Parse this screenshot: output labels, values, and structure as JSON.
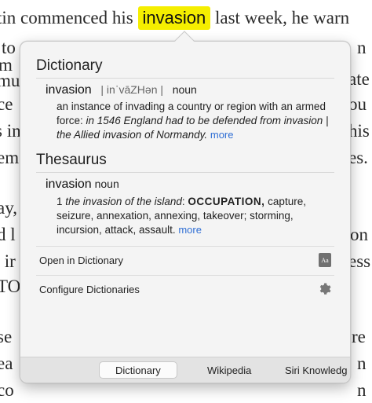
{
  "background": {
    "line1_before": "tin commenced his",
    "highlight_word": "invasion",
    "line1_after": "last week, he warn",
    "left_fragments": [
      "to",
      "m",
      "mu",
      "ce",
      "s in",
      "em",
      "ay,",
      "d l",
      "’ ir",
      "TO",
      "se",
      "ea",
      "co"
    ],
    "right_fragments": [
      "n",
      "ate",
      "ou",
      "his",
      "es.",
      "on",
      "ess",
      "re",
      "n",
      "n"
    ]
  },
  "popover": {
    "dictionary": {
      "title": "Dictionary",
      "headword": "invasion",
      "pronunciation": "| inˈvāZHən |",
      "pos": "noun",
      "definition": "an instance of invading a country or region with an armed force: ",
      "example": "in 1546 England had to be defended from invasion | the Allied invasion of Normandy.",
      "more": "more"
    },
    "thesaurus": {
      "title": "Thesaurus",
      "headword": "invasion",
      "pos": "noun",
      "sense_number": "1",
      "example": "the invasion of the island",
      "keyword": "OCCUPATION,",
      "synonyms": "capture, seizure, annexation, annexing, takeover; storming, incursion, attack, assault.",
      "more": "more"
    },
    "actions": {
      "open_dictionary": "Open in Dictionary",
      "dict_icon_text": "Aa",
      "configure": "Configure Dictionaries"
    },
    "tabs": [
      "Dictionary",
      "Wikipedia",
      "Siri Knowledge"
    ],
    "active_tab": "Dictionary",
    "accent_color": "#2f6ed4",
    "highlight_color": "#f5ee00"
  }
}
